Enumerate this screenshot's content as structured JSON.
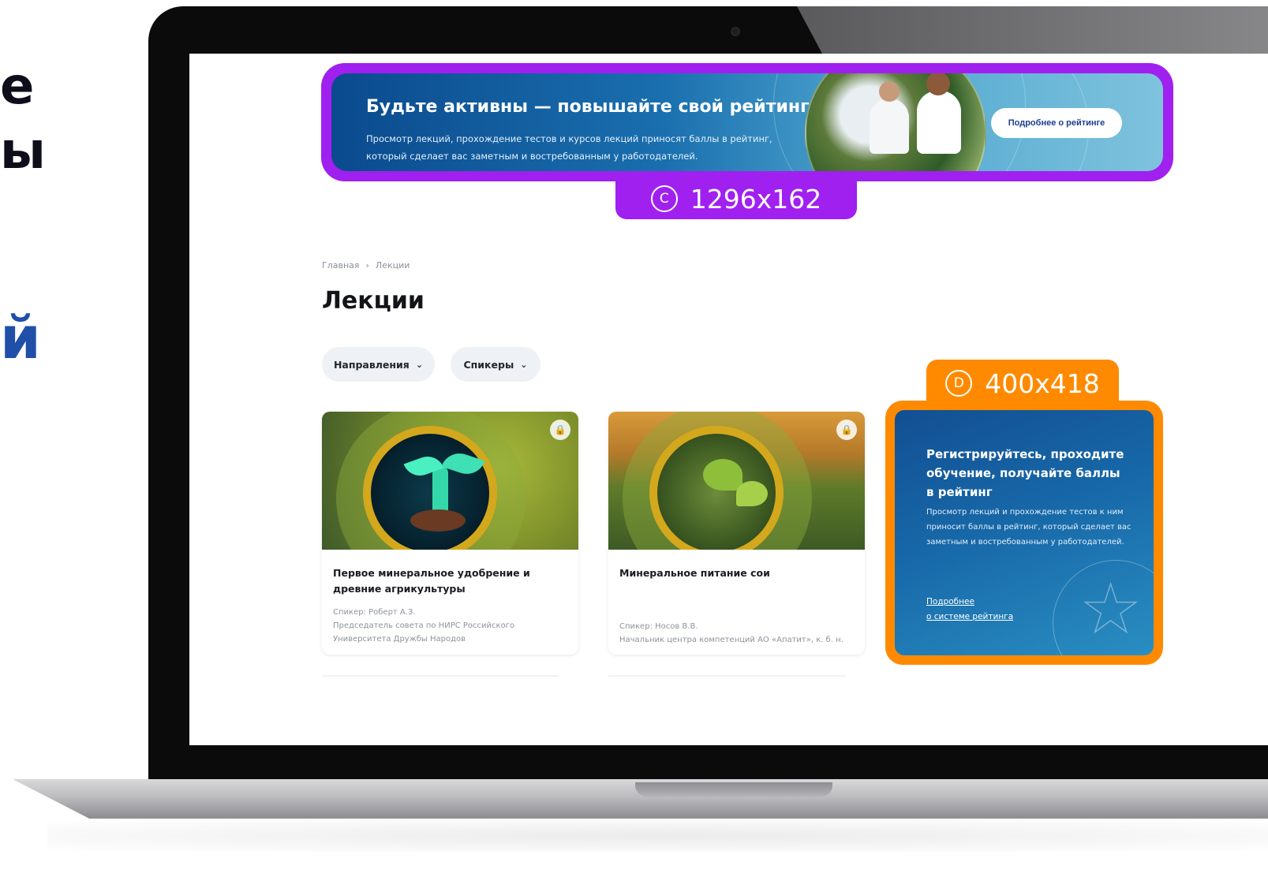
{
  "side_text": {
    "line1": "е",
    "line2": "ы",
    "line3": "й"
  },
  "banner": {
    "title": "Будьте активны — повышайте свой рейтинг",
    "description": "Просмотр лекций, прохождение тестов и курсов лекций приносят баллы в рейтинг, который сделает вас заметным и востребованным у работодателей.",
    "button_label": "Подробнее о рейтинге",
    "size_letter": "C",
    "size_label": "1296x162"
  },
  "breadcrumb": {
    "home": "Главная",
    "separator": "›",
    "current": "Лекции"
  },
  "page_title": "Лекции",
  "filters": [
    {
      "label": "Направления",
      "icon": "chevron-down-icon"
    },
    {
      "label": "Спикеры",
      "icon": "chevron-down-icon"
    }
  ],
  "cards": [
    {
      "title": "Первое минеральное удобрение и древние агрикультуры",
      "speaker": "Спикер: Роберт А.З.",
      "position": "Председатель совета по НИРС Российского Университета Дружбы Народов",
      "icon": "lock-icon"
    },
    {
      "title": "Минеральное питание сои",
      "speaker": "Спикер: Носов В.В.",
      "position": "Начальник центра компетенций АО «Апатит», к. б. н.",
      "icon": "lock-icon"
    }
  ],
  "promo": {
    "size_letter": "D",
    "size_label": "400x418",
    "title": "Регистрируйтесь, проходите обучение, получайте баллы в рейтинг",
    "description": "Просмотр лекций и прохождение тестов к ним приносит баллы в рейтинг, который сделает вас заметным и востребованным у работодателей.",
    "link_line1": "Подробнее",
    "link_line2": "о системе рейтинга",
    "icon": "star-icon"
  },
  "colors": {
    "banner_frame": "#a020f0",
    "promo_frame": "#ff8a00",
    "banner_gradient_start": "#0a4a8e",
    "title_text": "#121418"
  }
}
